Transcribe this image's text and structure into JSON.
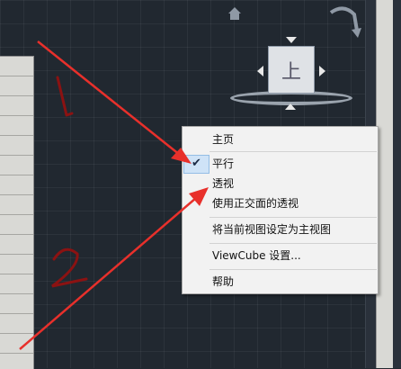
{
  "menu": {
    "items": [
      {
        "label": "主页",
        "checked": false
      },
      {
        "label": "平行",
        "checked": true
      },
      {
        "label": "透视",
        "checked": false
      },
      {
        "label": "使用正交面的透视",
        "checked": false
      },
      {
        "label": "将当前视图设定为主视图",
        "checked": false
      },
      {
        "label": "ViewCube 设置...",
        "checked": false
      },
      {
        "label": "帮助",
        "checked": false
      }
    ],
    "check_glyph": "✔"
  },
  "viewcube": {
    "face_label": "上",
    "icons": [
      "home-icon",
      "orbit-arrow-icon",
      "pan-arrow-icon",
      "compass-ring"
    ]
  },
  "annotations": {
    "colors": {
      "arrow": "#e8302b",
      "digit": "#8b1212"
    }
  }
}
